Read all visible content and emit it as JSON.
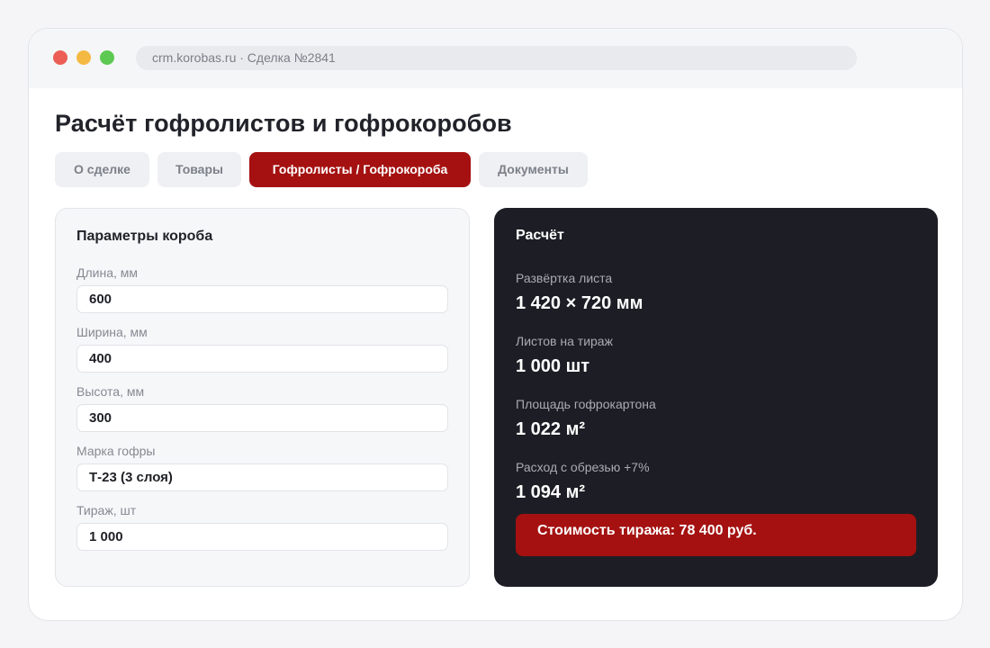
{
  "browser": {
    "url": "crm.korobas.ru · Сделка №2841"
  },
  "page": {
    "title": "Расчёт гофролистов и гофрокоробов"
  },
  "tabs": [
    {
      "label": "О сделке",
      "active": false
    },
    {
      "label": "Товары",
      "active": false
    },
    {
      "label": "Гофролисты / Гофрокороба",
      "active": true
    },
    {
      "label": "Документы",
      "active": false
    }
  ],
  "params": {
    "title": "Параметры короба",
    "fields": [
      {
        "label": "Длина, мм",
        "value": "600"
      },
      {
        "label": "Ширина, мм",
        "value": "400"
      },
      {
        "label": "Высота, мм",
        "value": "300"
      },
      {
        "label": "Марка гофры",
        "value": "Т-23 (3 слоя)"
      },
      {
        "label": "Тираж, шт",
        "value": "1 000"
      }
    ]
  },
  "calc": {
    "title": "Расчёт",
    "rows": [
      {
        "label": "Развёртка листа",
        "value": "1 420 × 720 мм"
      },
      {
        "label": "Листов на тираж",
        "value": "1 000 шт"
      },
      {
        "label": "Площадь гофрокартона",
        "value": "1 022 м²"
      },
      {
        "label": "Расход с обрезью +7%",
        "value": "1 094 м²"
      }
    ],
    "cost": "Стоимость тиража: 78 400 руб."
  },
  "colors": {
    "accent": "#a51111",
    "dark_panel": "#1d1e25",
    "window_dots": [
      "#ec5e55",
      "#f4b942",
      "#5ec952"
    ]
  }
}
